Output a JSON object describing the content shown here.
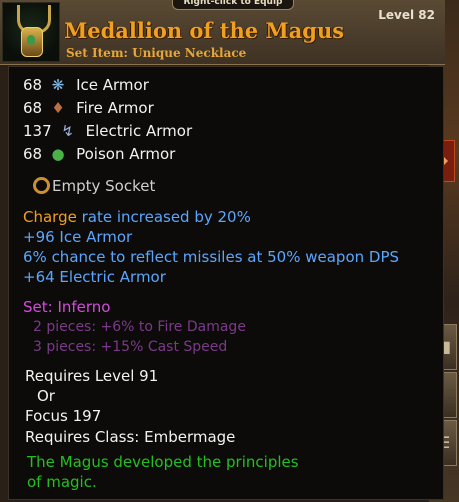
{
  "header": {
    "top_tab": "Right-click to Equip",
    "title": "Medallion of the Magus",
    "subtitle": "Set Item: Unique Necklace",
    "level": "Level 82"
  },
  "armor": [
    {
      "value": "68",
      "name": "Ice Armor",
      "icon": "snowflake-icon"
    },
    {
      "value": "68",
      "name": "Fire Armor",
      "icon": "flame-icon"
    },
    {
      "value": "137",
      "name": "Electric Armor",
      "icon": "lightning-icon"
    },
    {
      "value": "68",
      "name": "Poison Armor",
      "icon": "poison-icon"
    }
  ],
  "socket": "Empty Socket",
  "mods": {
    "charge_word": "Charge",
    "charge_rest": " rate increased by 20%",
    "ice": "+96 Ice Armor",
    "reflect": "6% chance to reflect missiles at 50% weapon DPS",
    "electric": "+64 Electric Armor"
  },
  "set": {
    "name": "Set: Inferno",
    "bonuses": [
      "2 pieces: +6% to Fire Damage",
      "3 pieces: +15% Cast Speed"
    ]
  },
  "requirements": [
    "Requires Level 91",
    "Or",
    "Focus 197",
    "Requires Class: Embermage"
  ],
  "flavor": [
    "The Magus developed the principles",
    "of magic."
  ],
  "colors": {
    "title": "#f0a020",
    "mod_blue": "#5aa6ff",
    "set_purple": "#d44ae0",
    "flavor_green": "#22c020"
  }
}
